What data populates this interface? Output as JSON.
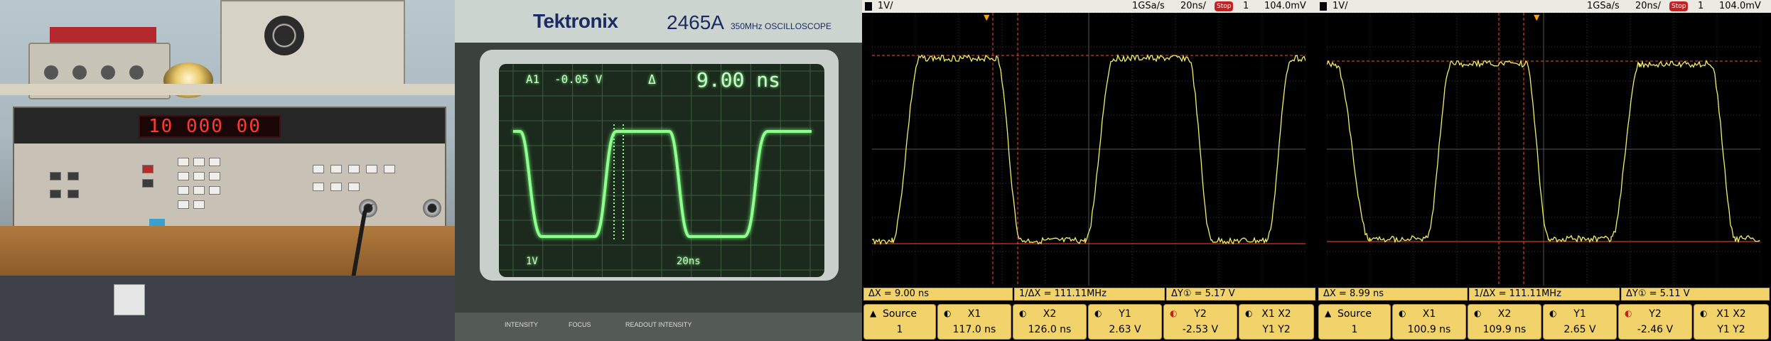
{
  "photo_generator": {
    "display_value": "10 000 00"
  },
  "photo_scope": {
    "brand": "Tektronix",
    "model": "2465A",
    "subtitle": "350MHz OSCILLOSCOPE",
    "readout_ch": "A1",
    "readout_volts": "-0.05 V",
    "readout_delta": "Δ",
    "readout_time": "9.00 ns",
    "scale_ch": "1V",
    "scale_time": "20ns",
    "bottom_labels": [
      "INTENSITY",
      "FOCUS",
      "READOUT INTENSITY"
    ]
  },
  "captures": [
    {
      "top": {
        "channel_scale": "1V/",
        "sample_rate": "1GSa/s",
        "timebase": "20ns/",
        "stop_label": "Stop",
        "trigger": "1",
        "trigger_level": "104.0mV"
      },
      "stats": {
        "delta_x": "ΔX = 9.00 ns",
        "inv_delta_x": "1/ΔX = 111.11MHz",
        "delta_y": "ΔY① = 5.17 V"
      },
      "softkeys": {
        "source_label": "Source",
        "source_value": "1",
        "x1_label": "X1",
        "x1_value": "117.0 ns",
        "x2_label": "X2",
        "x2_value": "126.0 ns",
        "y1_label": "Y1",
        "y1_value": "2.63 V",
        "y2_label": "Y2",
        "y2_value": "-2.53 V",
        "xy_line1": "X1 X2",
        "xy_line2": "Y1 Y2"
      }
    },
    {
      "top": {
        "channel_scale": "1V/",
        "sample_rate": "1GSa/s",
        "timebase": "20ns/",
        "stop_label": "Stop",
        "trigger": "1",
        "trigger_level": "104.0mV"
      },
      "stats": {
        "delta_x": "ΔX = 8.99 ns",
        "inv_delta_x": "1/ΔX = 111.11MHz",
        "delta_y": "ΔY① = 5.11 V"
      },
      "softkeys": {
        "source_label": "Source",
        "source_value": "1",
        "x1_label": "X1",
        "x1_value": "100.9 ns",
        "x2_label": "X2",
        "x2_value": "109.9 ns",
        "y1_label": "Y1",
        "y1_value": "2.65 V",
        "y2_label": "Y2",
        "y2_value": "-2.46 V",
        "xy_line1": "X1 X2",
        "xy_line2": "Y1 Y2"
      }
    }
  ],
  "colors": {
    "trace": "#f2f266",
    "cursor_x": "#ff4a2a",
    "cursor_y": "#ff4a2a",
    "softkey_bg": "#f1d26b",
    "scope_phosphor": "#7dff7d"
  }
}
